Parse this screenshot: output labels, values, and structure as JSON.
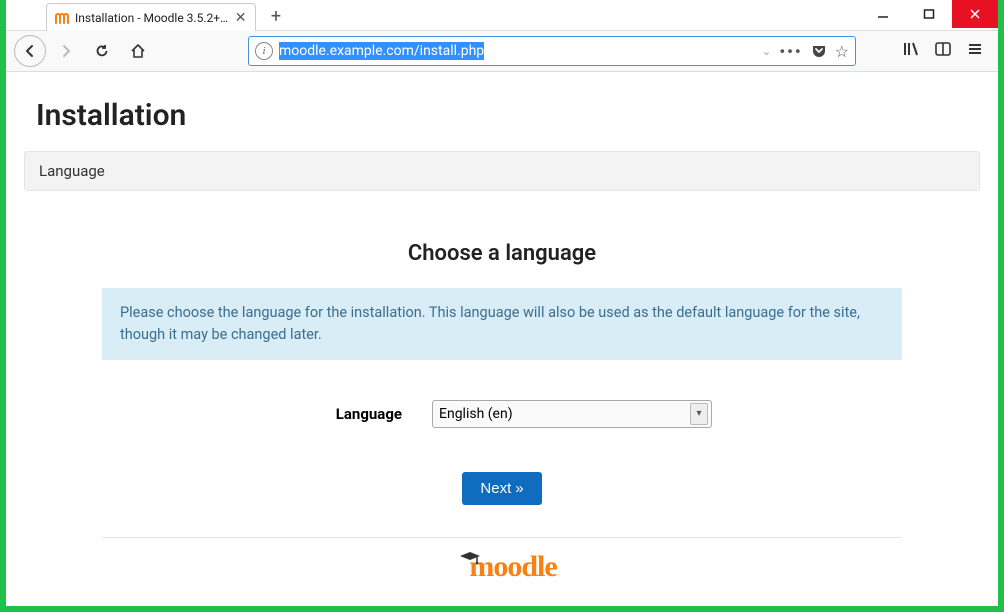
{
  "window": {
    "tab_title": "Installation - Moodle 3.5.2+ (B…"
  },
  "urlbar": {
    "url": "moodle.example.com/install.php"
  },
  "page": {
    "title": "Installation",
    "panel_header": "Language",
    "heading": "Choose a language",
    "alert": "Please choose the language for the installation. This language will also be used as the default language for the site, though it may be changed later.",
    "form": {
      "label": "Language",
      "selected": "English (en)"
    },
    "next_label": "Next",
    "logo_text": "moodle"
  }
}
